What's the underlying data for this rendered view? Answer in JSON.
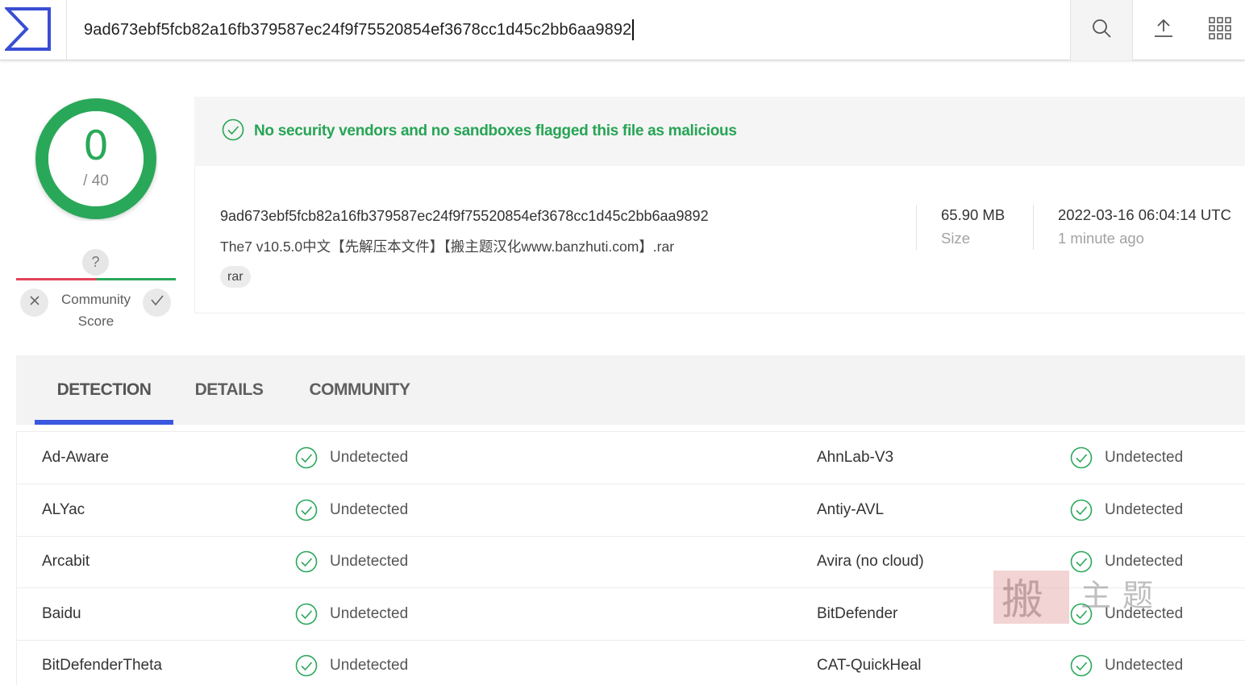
{
  "topbar": {
    "search_value": "9ad673ebf5fcb82a16fb379587ec24f9f75520854ef3678cc1d45c2bb6aa9892",
    "icons": [
      "virustotal-logo",
      "search-icon",
      "upload-icon",
      "apps-grid-icon"
    ]
  },
  "score": {
    "detections": "0",
    "total": "/ 40",
    "color": "#2aa85a"
  },
  "community": {
    "question": "?",
    "label": "Community Score"
  },
  "verdict": {
    "text": "No security vendors and no sandboxes flagged this file as malicious",
    "color": "#27a455"
  },
  "file": {
    "hash": "9ad673ebf5fcb82a16fb379587ec24f9f75520854ef3678cc1d45c2bb6aa9892",
    "name": "The7 v10.5.0中文【先解压本文件】【搬主题汉化www.banzhuti.com】.rar",
    "tag": "rar",
    "size": "65.90 MB",
    "size_label": "Size",
    "date": "2022-03-16 06:04:14 UTC",
    "date_ago": "1 minute ago"
  },
  "tabs": [
    {
      "label": "DETECTION",
      "active": true
    },
    {
      "label": "DETAILS",
      "active": false
    },
    {
      "label": "COMMUNITY",
      "active": false
    }
  ],
  "detections": [
    {
      "left_vendor": "Ad-Aware",
      "left_status": "Undetected",
      "right_vendor": "AhnLab-V3",
      "right_status": "Undetected"
    },
    {
      "left_vendor": "ALYac",
      "left_status": "Undetected",
      "right_vendor": "Antiy-AVL",
      "right_status": "Undetected"
    },
    {
      "left_vendor": "Arcabit",
      "left_status": "Undetected",
      "right_vendor": "Avira (no cloud)",
      "right_status": "Undetected"
    },
    {
      "left_vendor": "Baidu",
      "left_status": "Undetected",
      "right_vendor": "BitDefender",
      "right_status": "Undetected"
    },
    {
      "left_vendor": "BitDefenderTheta",
      "left_status": "Undetected",
      "right_vendor": "CAT-QuickHeal",
      "right_status": "Undetected"
    }
  ],
  "watermark": {
    "text": "搬主题"
  },
  "colors": {
    "accent": "#3a57e0",
    "success": "#2aa85a",
    "danger": "#e0445a"
  }
}
